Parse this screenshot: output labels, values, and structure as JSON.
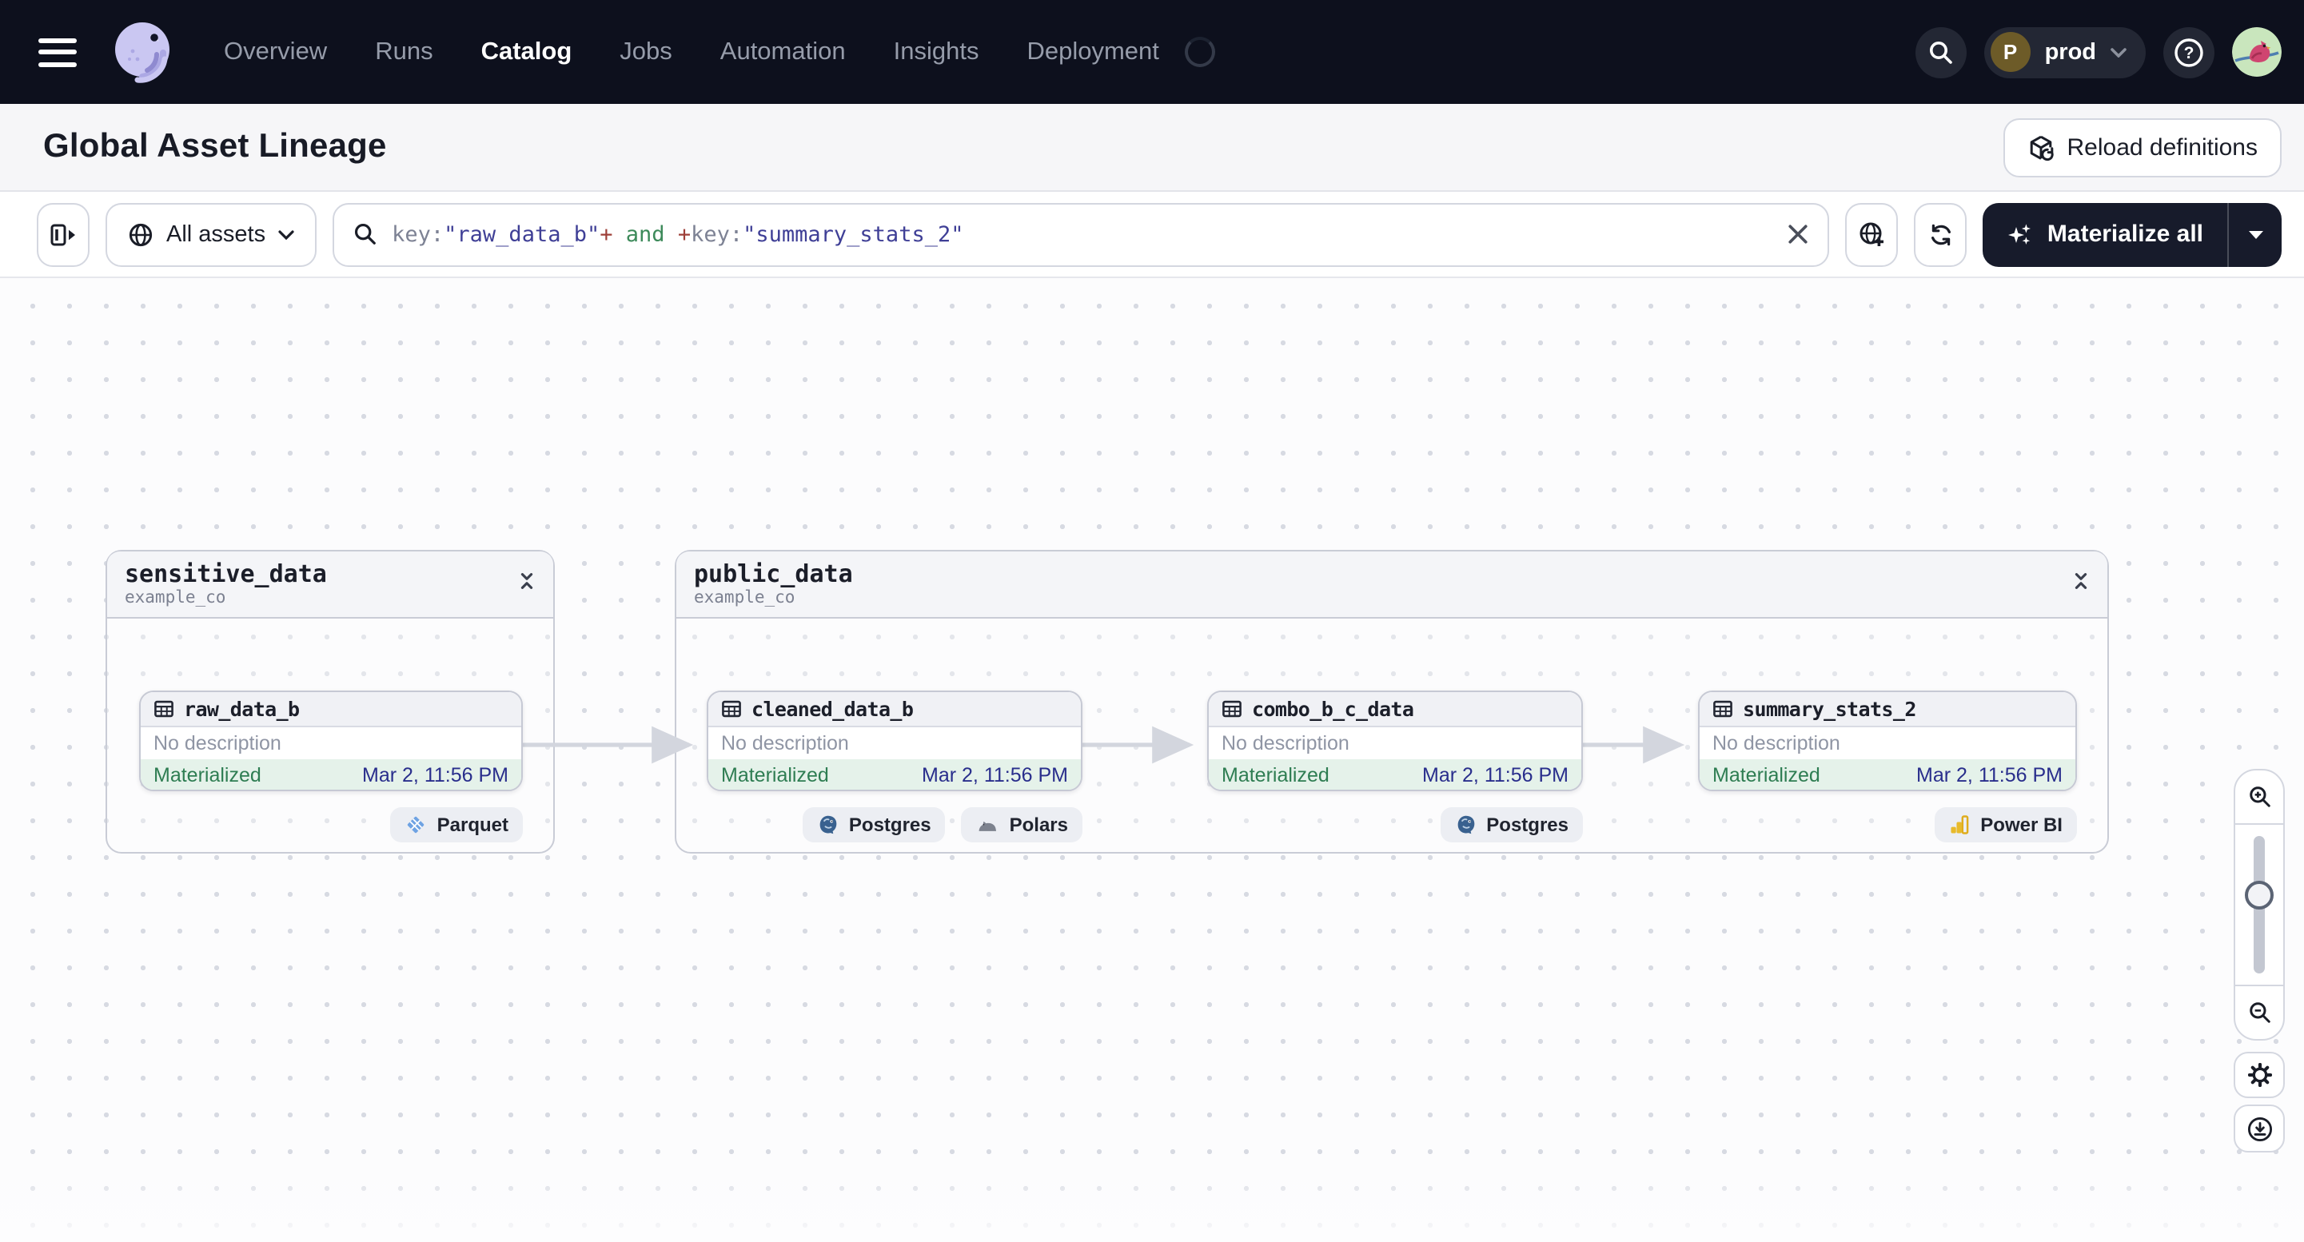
{
  "nav": {
    "items": [
      "Overview",
      "Runs",
      "Catalog",
      "Jobs",
      "Automation",
      "Insights",
      "Deployment"
    ],
    "active_item": "Catalog",
    "deployment": {
      "initial": "P",
      "name": "prod"
    },
    "help_symbol": "?"
  },
  "header": {
    "title": "Global Asset Lineage",
    "reload_button": "Reload definitions"
  },
  "toolbar": {
    "filter_label": "All assets",
    "search": {
      "segments": [
        {
          "text": "key:",
          "color": "#7d8294"
        },
        {
          "text": "\"raw_data_b\"",
          "color": "#3f3f96"
        },
        {
          "text": "+",
          "color": "#9e3f38"
        },
        {
          "text": " and ",
          "color": "#3d8a5a"
        },
        {
          "text": "+",
          "color": "#9e3f38"
        },
        {
          "text": "key:",
          "color": "#7d8294"
        },
        {
          "text": "\"summary_stats_2\"",
          "color": "#3f3f96"
        }
      ]
    },
    "materialize_button": "Materialize all"
  },
  "graph": {
    "groups": [
      {
        "name": "sensitive_data",
        "repo": "example_co"
      },
      {
        "name": "public_data",
        "repo": "example_co"
      }
    ],
    "nodes": [
      {
        "name": "raw_data_b",
        "description": "No description",
        "status": "Materialized",
        "timestamp": "Mar 2, 11:56 PM",
        "tags": [
          "Parquet"
        ]
      },
      {
        "name": "cleaned_data_b",
        "description": "No description",
        "status": "Materialized",
        "timestamp": "Mar 2, 11:56 PM",
        "tags": [
          "Postgres",
          "Polars"
        ]
      },
      {
        "name": "combo_b_c_data",
        "description": "No description",
        "status": "Materialized",
        "timestamp": "Mar 2, 11:56 PM",
        "tags": [
          "Postgres"
        ]
      },
      {
        "name": "summary_stats_2",
        "description": "No description",
        "status": "Materialized",
        "timestamp": "Mar 2, 11:56 PM",
        "tags": [
          "Power BI"
        ]
      }
    ],
    "edges": [
      {
        "from": "raw_data_b",
        "to": "cleaned_data_b"
      },
      {
        "from": "cleaned_data_b",
        "to": "combo_b_c_data"
      },
      {
        "from": "combo_b_c_data",
        "to": "summary_stats_2"
      }
    ]
  },
  "colors": {
    "nav_bg": "#0d101d",
    "accent_dark": "#171b2b",
    "status_green": "#2e7d52",
    "status_bg": "#e5f2ea",
    "timestamp_navy": "#292e8c",
    "border": "#d4d7e0",
    "canvas_dot": "#d7dae2"
  }
}
